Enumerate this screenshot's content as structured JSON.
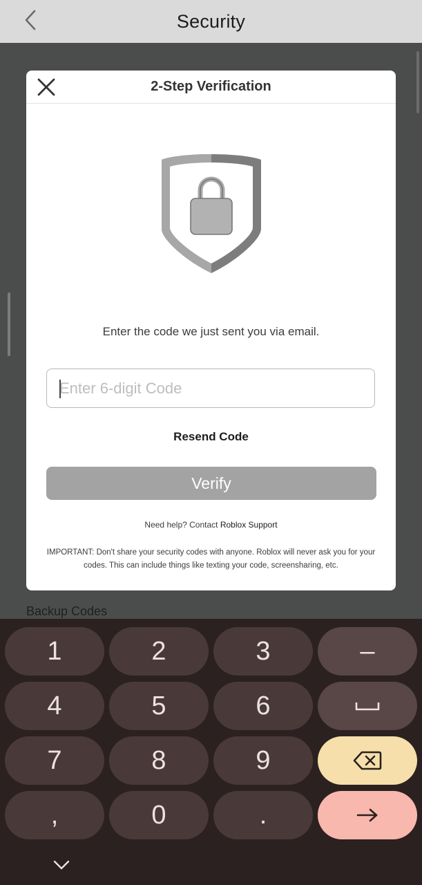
{
  "appbar": {
    "title": "Security",
    "back_icon": "chevron-left-icon"
  },
  "background": {
    "section_label": "Backup Codes"
  },
  "modal": {
    "title": "2-Step Verification",
    "close_icon": "close-icon",
    "illustration": "shield-lock-icon",
    "instruction": "Enter the code we just sent you via email.",
    "code_input": {
      "placeholder": "Enter 6-digit Code",
      "value": ""
    },
    "resend_label": "Resend Code",
    "verify_label": "Verify",
    "help_prefix": "Need help? Contact",
    "help_link": "Roblox Support",
    "important_text": "IMPORTANT: Don't share your security codes with anyone. Roblox will never ask you for your codes. This can include things like texting your code, screensharing, etc."
  },
  "keyboard": {
    "keys": {
      "k1": "1",
      "k2": "2",
      "k3": "3",
      "kminus": "–",
      "k4": "4",
      "k5": "5",
      "k6": "6",
      "k7": "7",
      "k8": "8",
      "k9": "9",
      "kcomma": ",",
      "k0": "0",
      "kdot": "."
    },
    "icons": {
      "space": "space-icon",
      "backspace": "backspace-icon",
      "enter": "arrow-right-icon",
      "hide": "chevron-down-icon"
    }
  },
  "colors": {
    "appbar_bg": "#dadada",
    "overlay_bg": "#4b4d4c",
    "verify_disabled": "#a3a3a3",
    "keyboard_bg": "#2b2120",
    "key_bg": "#493a39",
    "backspace_key": "#f6dfab",
    "enter_key": "#f9b8ad"
  }
}
